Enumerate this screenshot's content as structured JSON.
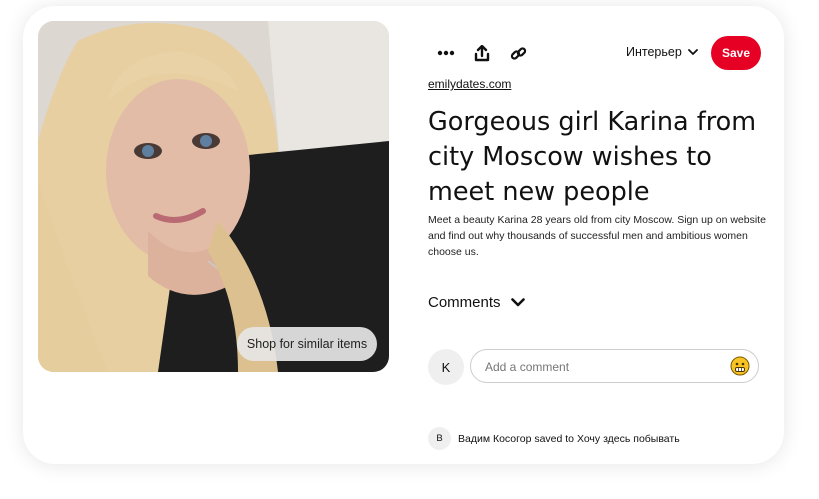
{
  "pin": {
    "image_alt": "Photo of a blonde woman",
    "shop_label": "Shop for similar items"
  },
  "actions": {
    "more_icon": "more-icon",
    "share_icon": "share-icon",
    "link_icon": "link-icon"
  },
  "board": {
    "name": "Интерьер"
  },
  "save_label": "Save",
  "source": "emilydates.com",
  "title": "Gorgeous girl Karina from city Moscow wishes to meet new people",
  "description": "Meet a beauty Karina 28 years old from city Moscow. Sign up on website and find out why thousands of successful men and ambitious women choose us.",
  "comments": {
    "heading": "Comments",
    "user_initial": "K",
    "placeholder": "Add a comment"
  },
  "activity": {
    "initial": "В",
    "text": "Вадим Косогор saved to Хочу здесь побывать"
  },
  "colors": {
    "save_button": "#e60023",
    "card_bg": "#ffffff"
  }
}
